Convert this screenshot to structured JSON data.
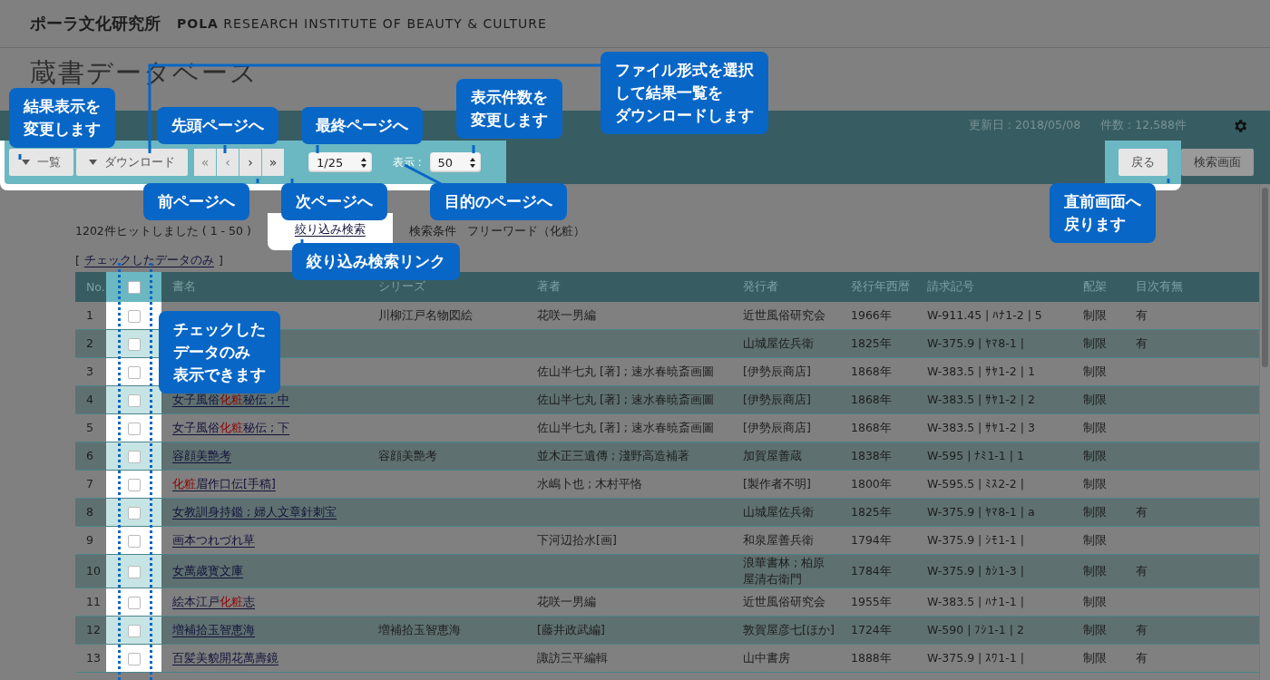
{
  "header": {
    "brand_jp": "ポーラ文化研究所",
    "brand_en": "**POLA** RESEARCH INSTITUTE OF BEAUTY & CULTURE"
  },
  "page_title": "蔵書データベース",
  "info": {
    "updated": "更新日 : 2018/05/08",
    "count": "件数 : 12,588件"
  },
  "toolbar": {
    "view_button": "一覧",
    "download_button": "ダウンロード",
    "nav": [
      {
        "label": "«",
        "disabled": true
      },
      {
        "label": "‹",
        "disabled": true
      },
      {
        "label": "›",
        "disabled": false
      },
      {
        "label": "»",
        "disabled": false
      }
    ],
    "page_select": "1/25",
    "per_page_label": "表示 :",
    "per_page_select": "50"
  },
  "actions": [
    {
      "label": "戻る",
      "highlighted": true
    },
    {
      "label": "検索画面",
      "highlighted": false
    }
  ],
  "results": {
    "summary": "1202件ヒットしました ( 1 - 50 )",
    "refine_link": "絞り込み検索",
    "conditions_label": "検索条件",
    "conditions": "フリーワード（化粧）",
    "bracket_open": "[",
    "checked_only_link": "チェックしたデータのみ",
    "bracket_close": "]"
  },
  "table": {
    "columns": [
      {
        "kind": "text",
        "label": "No."
      },
      {
        "kind": "checkbox",
        "checked": false
      },
      {
        "kind": "text",
        "label": "書名"
      },
      {
        "kind": "text",
        "label": "シリーズ"
      },
      {
        "kind": "text",
        "label": "著者"
      },
      {
        "kind": "text",
        "label": "発行者"
      },
      {
        "kind": "text",
        "label": "発行年西暦"
      },
      {
        "kind": "text",
        "label": "請求記号"
      },
      {
        "kind": "text",
        "label": "配架"
      },
      {
        "kind": "text",
        "label": "目次有無"
      }
    ],
    "rows": [
      {
        "no": "1",
        "checked": false,
        "series": "川柳江戸名物図絵",
        "author": "花咲一男編",
        "publisher": "近世風俗研究会",
        "year": "1966年",
        "call_number": "W-911.45 | ﾊﾅ1-2 | 5",
        "shelf": "制限",
        "toc": "有"
      },
      {
        "no": "2",
        "checked": false,
        "publisher": "山城屋佐兵衛",
        "year": "1825年",
        "call_number": "W-375.9 | ﾔﾏ8-1 |",
        "shelf": "制限",
        "toc": "有"
      },
      {
        "no": "3",
        "checked": false,
        "author": "佐山半七丸 [著] ; 速水春暁斎画圖",
        "publisher": "[伊勢辰商店]",
        "year": "1868年",
        "call_number": "W-383.5 | ｻﾔ1-2 | 1",
        "shelf": "制限"
      },
      {
        "no": "4",
        "checked": false,
        "title": [
          {
            "text": "女子風俗"
          },
          {
            "text": "化粧",
            "match": true
          },
          {
            "text": "秘伝 ; 中"
          }
        ],
        "author": "佐山半七丸 [著] ; 速水春暁斎画圖",
        "publisher": "[伊勢辰商店]",
        "year": "1868年",
        "call_number": "W-383.5 | ｻﾔ1-2 | 2",
        "shelf": "制限"
      },
      {
        "no": "5",
        "checked": false,
        "title": [
          {
            "text": "女子風俗"
          },
          {
            "text": "化粧",
            "match": true
          },
          {
            "text": "秘伝 ; 下"
          }
        ],
        "author": "佐山半七丸 [著] ; 速水春暁斎画圖",
        "publisher": "[伊勢辰商店]",
        "year": "1868年",
        "call_number": "W-383.5 | ｻﾔ1-2 | 3",
        "shelf": "制限"
      },
      {
        "no": "6",
        "checked": false,
        "title": [
          {
            "text": "容顔美艶考"
          }
        ],
        "series": "容顔美艶考",
        "author": "並木正三遺傳 ; 淺野高造補著",
        "publisher": "加賀屋善蔵",
        "year": "1838年",
        "call_number": "W-595 | ﾅﾐ1-1 | 1",
        "shelf": "制限"
      },
      {
        "no": "7",
        "checked": false,
        "title": [
          {
            "text": "化粧",
            "match": true
          },
          {
            "text": "眉作口伝[手稿]"
          }
        ],
        "author": "水嶋卜也 ; 木村平恪",
        "publisher": "[製作者不明]",
        "year": "1800年",
        "call_number": "W-595.5 | ﾐｽ2-2 |",
        "shelf": "制限"
      },
      {
        "no": "8",
        "checked": false,
        "title": [
          {
            "text": "女教訓身持鑑 ; 婦人文章針刺宝"
          }
        ],
        "publisher": "山城屋佐兵衛",
        "year": "1825年",
        "call_number": "W-375.9 | ﾔﾏ8-1 | a",
        "shelf": "制限",
        "toc": "有"
      },
      {
        "no": "9",
        "checked": false,
        "title": [
          {
            "text": "画本つれづれ草"
          }
        ],
        "author": "下河辺拾水[画]",
        "publisher": "和泉屋善兵衛",
        "year": "1794年",
        "call_number": "W-375.9 | ｼﾓ1-1 |",
        "shelf": "制限"
      },
      {
        "no": "10",
        "checked": false,
        "title": [
          {
            "text": "女萬歳寳文庫"
          }
        ],
        "publisher": "浪華書林 ; 柏原屋清右衛門",
        "year": "1784年",
        "call_number": "W-375.9 | ｶｼ1-3 |",
        "shelf": "制限",
        "toc": "有"
      },
      {
        "no": "11",
        "checked": false,
        "title": [
          {
            "text": "絵本江戸"
          },
          {
            "text": "化粧",
            "match": true
          },
          {
            "text": "志"
          }
        ],
        "author": "花咲一男編",
        "publisher": "近世風俗研究会",
        "year": "1955年",
        "call_number": "W-383.5 | ﾊﾅ1-1 |",
        "shelf": "制限"
      },
      {
        "no": "12",
        "checked": false,
        "title": [
          {
            "text": "増補拾玉智恵海"
          }
        ],
        "series": "増補拾玉智恵海",
        "author": "[藤井政武編]",
        "publisher": "敦賀屋彦七[ほか]",
        "year": "1724年",
        "call_number": "W-590 | ﾌｼ1-1 | 2",
        "shelf": "制限",
        "toc": "有"
      },
      {
        "no": "13",
        "checked": false,
        "title": [
          {
            "text": "百髪美貌開花萬壽鏡"
          }
        ],
        "author": "諏訪三平編輯",
        "publisher": "山中書房",
        "year": "1888年",
        "call_number": "W-375.9 | ｽﾜ1-1 |",
        "shelf": "制限",
        "toc": "有"
      }
    ]
  },
  "callouts": [
    {
      "lines": [
        "結果表示を",
        "変更します"
      ]
    },
    {
      "lines": [
        "先頭ページへ"
      ]
    },
    {
      "lines": [
        "最終ページへ"
      ]
    },
    {
      "lines": [
        "表示件数を",
        "変更します"
      ]
    },
    {
      "lines": [
        "ファイル形式を選択",
        "して結果一覧を",
        "ダウンロードします"
      ]
    },
    {
      "lines": [
        "前ページへ"
      ]
    },
    {
      "lines": [
        "次ページへ"
      ]
    },
    {
      "lines": [
        "目的のページへ"
      ]
    },
    {
      "lines": [
        "直前画面へ",
        "戻ります"
      ]
    },
    {
      "lines": [
        "絞り込み検索リンク"
      ]
    },
    {
      "lines": [
        "チェックした",
        "データのみ",
        "表示できます"
      ]
    }
  ]
}
